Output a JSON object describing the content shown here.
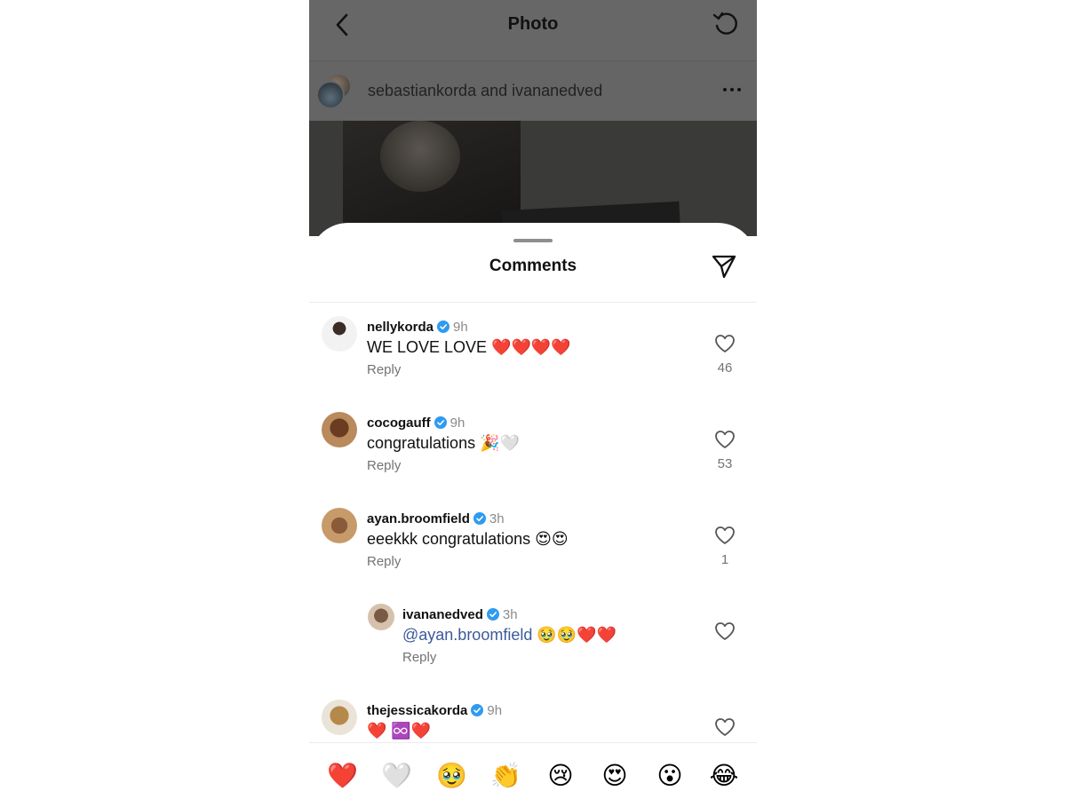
{
  "header": {
    "title": "Photo"
  },
  "post": {
    "authors": "sebastiankorda and ivananedved"
  },
  "sheet": {
    "title": "Comments"
  },
  "comments": [
    {
      "user": "nellykorda",
      "time": "9h",
      "text": "WE LOVE LOVE ❤️❤️❤️❤️",
      "reply": "Reply",
      "likes": "46"
    },
    {
      "user": "cocogauff",
      "time": "9h",
      "text": "congratulations 🎉🤍",
      "reply": "Reply",
      "likes": "53"
    },
    {
      "user": "ayan.broomfield",
      "time": "3h",
      "text": "eeekkk congratulations 😍😍",
      "reply": "Reply",
      "likes": "1"
    },
    {
      "user": "ivananedved",
      "time": "3h",
      "mention": "@ayan.broomfield",
      "text": " 🥹🥹❤️❤️",
      "reply": "Reply",
      "likes": ""
    },
    {
      "user": "thejessicakorda",
      "time": "9h",
      "text": "❤️ ♾️❤️",
      "reply": "",
      "likes": ""
    }
  ],
  "reactions": [
    "❤️",
    "🤍",
    "🥹",
    "👏",
    "😢",
    "😍",
    "😮",
    "😂"
  ],
  "icons": {
    "back": "chevron-left-icon",
    "refresh": "refresh-icon",
    "more": "more-horizontal-icon",
    "share": "paper-plane-icon",
    "like": "heart-outline-icon",
    "verified": "verified-badge-icon"
  },
  "colors": {
    "verified": "#2f9bf0",
    "mention": "#3c5a99",
    "muted": "#737373"
  }
}
